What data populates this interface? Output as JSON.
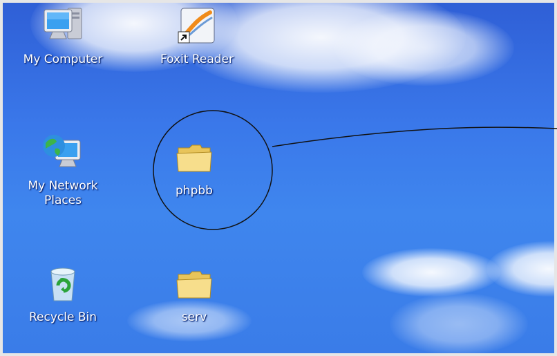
{
  "desktop": {
    "icons": [
      {
        "label": "My Computer",
        "icon": "computer-icon"
      },
      {
        "label": "Foxit Reader",
        "icon": "foxit-reader-shortcut-icon"
      },
      {
        "label": "My Network\nPlaces",
        "icon": "network-places-icon"
      },
      {
        "label": "phpbb",
        "icon": "folder-icon"
      },
      {
        "label": "Recycle Bin",
        "icon": "recycle-bin-icon"
      },
      {
        "label": "serv",
        "icon": "folder-icon"
      }
    ]
  },
  "colors": {
    "sky_top": "#2f5fd6",
    "sky_bottom": "#3f86ee",
    "folder_yellow": "#f5d77a",
    "annotation_stroke": "#111111"
  }
}
